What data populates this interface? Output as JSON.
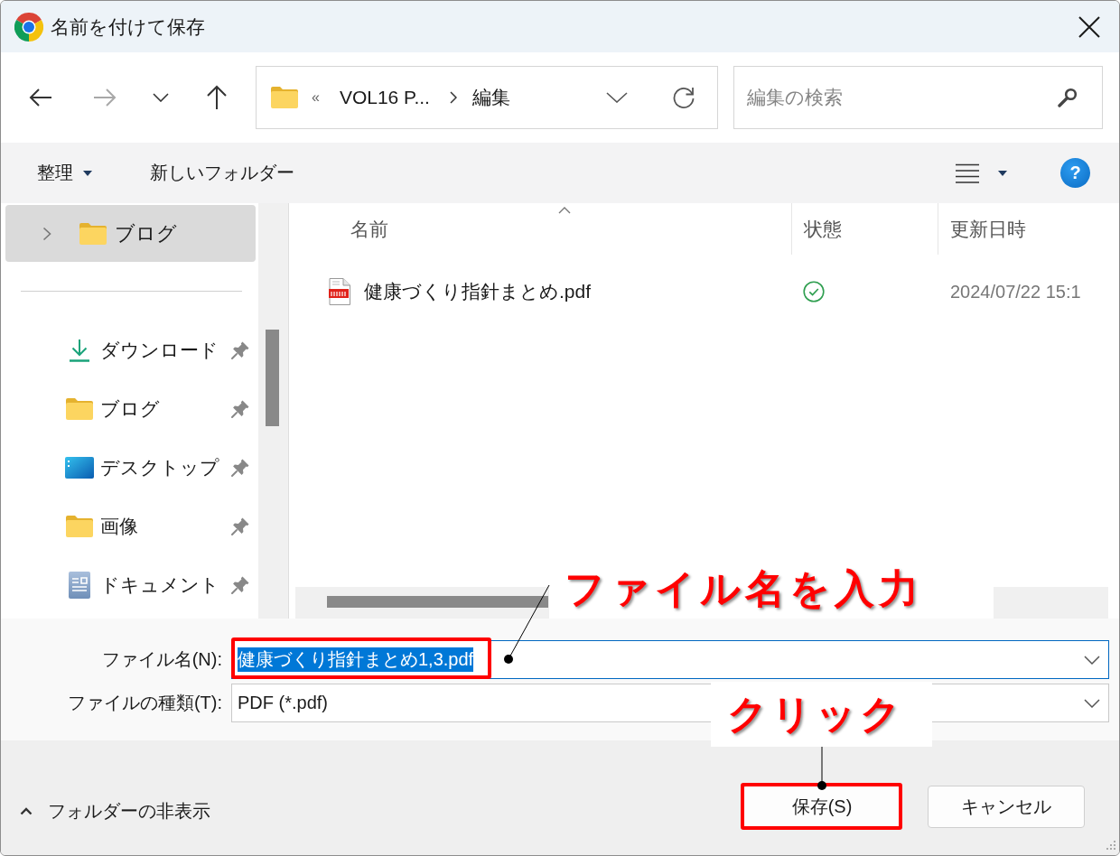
{
  "window": {
    "title": "名前を付けて保存"
  },
  "navigation": {
    "buttons": [
      {
        "kind": "back",
        "disabled": false
      },
      {
        "kind": "forward",
        "disabled": true
      },
      {
        "kind": "recent",
        "disabled": false
      },
      {
        "kind": "up",
        "disabled": false
      }
    ],
    "address": {
      "overflow_mark": "«",
      "segments": [
        "VOL16 P...",
        "編集"
      ]
    },
    "search": {
      "placeholder": "編集の検索"
    }
  },
  "toolbar": {
    "organize": "整理",
    "new_folder": "新しいフォルダー",
    "help": "?"
  },
  "sidebar": {
    "tree": [
      {
        "label": "ブログ",
        "kind": "folder",
        "selected": true,
        "expanded": false
      }
    ],
    "quick_access": [
      {
        "label": "ダウンロード",
        "kind": "download",
        "pinned": true,
        "selected": false
      },
      {
        "label": "ブログ",
        "kind": "folder",
        "pinned": true,
        "selected": false
      },
      {
        "label": "デスクトップ",
        "kind": "desktop",
        "pinned": true,
        "selected": false
      },
      {
        "label": "画像",
        "kind": "folder",
        "pinned": true,
        "selected": false
      },
      {
        "label": "ドキュメント",
        "kind": "documents",
        "pinned": true,
        "selected": false
      }
    ]
  },
  "file_list": {
    "columns": [
      {
        "label": "名前",
        "sorted": true
      },
      {
        "label": "状態",
        "sorted": false
      },
      {
        "label": "更新日時",
        "sorted": false
      }
    ],
    "rows": [
      {
        "name": "健康づくり指針まとめ.pdf",
        "kind": "pdf",
        "synced": true,
        "modified": "2024/07/22 15:1",
        "selected": false
      }
    ]
  },
  "form": {
    "fields": [
      {
        "label": "ファイル名(N):",
        "value": "健康づくり指針まとめ1,3.pdf",
        "focused": true,
        "value_selected": true,
        "highlighted": true
      },
      {
        "label": "ファイルの種類(T):",
        "value": "PDF (*.pdf)",
        "focused": false,
        "value_selected": false,
        "highlighted": false
      }
    ]
  },
  "footer": {
    "folders_toggle": {
      "label": "フォルダーの非表示",
      "expanded": true
    },
    "buttons": [
      {
        "label": "保存(S)",
        "highlighted": true
      },
      {
        "label": "キャンセル",
        "highlighted": false
      }
    ]
  },
  "annotations": [
    {
      "text": "ファイル名を入力"
    },
    {
      "text": "クリック"
    }
  ]
}
